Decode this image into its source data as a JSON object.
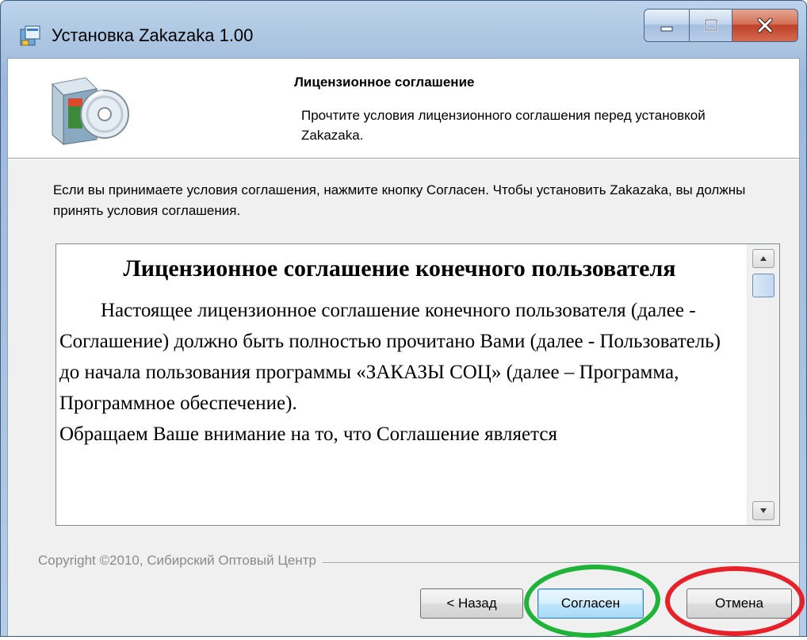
{
  "window": {
    "title": "Установка Zakazaka 1.00",
    "controls": {
      "minimize": "minimize",
      "maximize": "maximize",
      "close": "close"
    }
  },
  "header": {
    "title": "Лицензионное соглашение",
    "subtitle": "Прочтите условия лицензионного соглашения перед установкой Zakazaka."
  },
  "instruction": "Если вы принимаете условия соглашения, нажмите кнопку Согласен. Чтобы установить Zakazaka, вы должны принять условия соглашения.",
  "license": {
    "heading": "Лицензионное соглашение конечного пользователя",
    "paragraph1": "Настоящее лицензионное соглашение конечного пользователя (далее  - Соглашение) должно быть полностью прочитано Вами (далее - Пользователь) до начала пользования программы «ЗАКАЗЫ СОЦ» (далее – Программа, Программное обеспечение).",
    "paragraph2": "Обращаем Ваше внимание на то, что Соглашение является"
  },
  "footer": {
    "copyright": "Copyright ©2010, Сибирский Оптовый Центр"
  },
  "buttons": {
    "back": "< Назад",
    "agree": "Согласен",
    "cancel": "Отмена"
  },
  "icons": {
    "title": "setup-app-icon",
    "header": "installer-box-cd-icon",
    "scroll_up": "scroll-up-arrow-icon",
    "scroll_down": "scroll-down-arrow-icon"
  },
  "annotations": {
    "agree_highlight_color": "#1fb33a",
    "cancel_highlight_color": "#e8202a"
  }
}
